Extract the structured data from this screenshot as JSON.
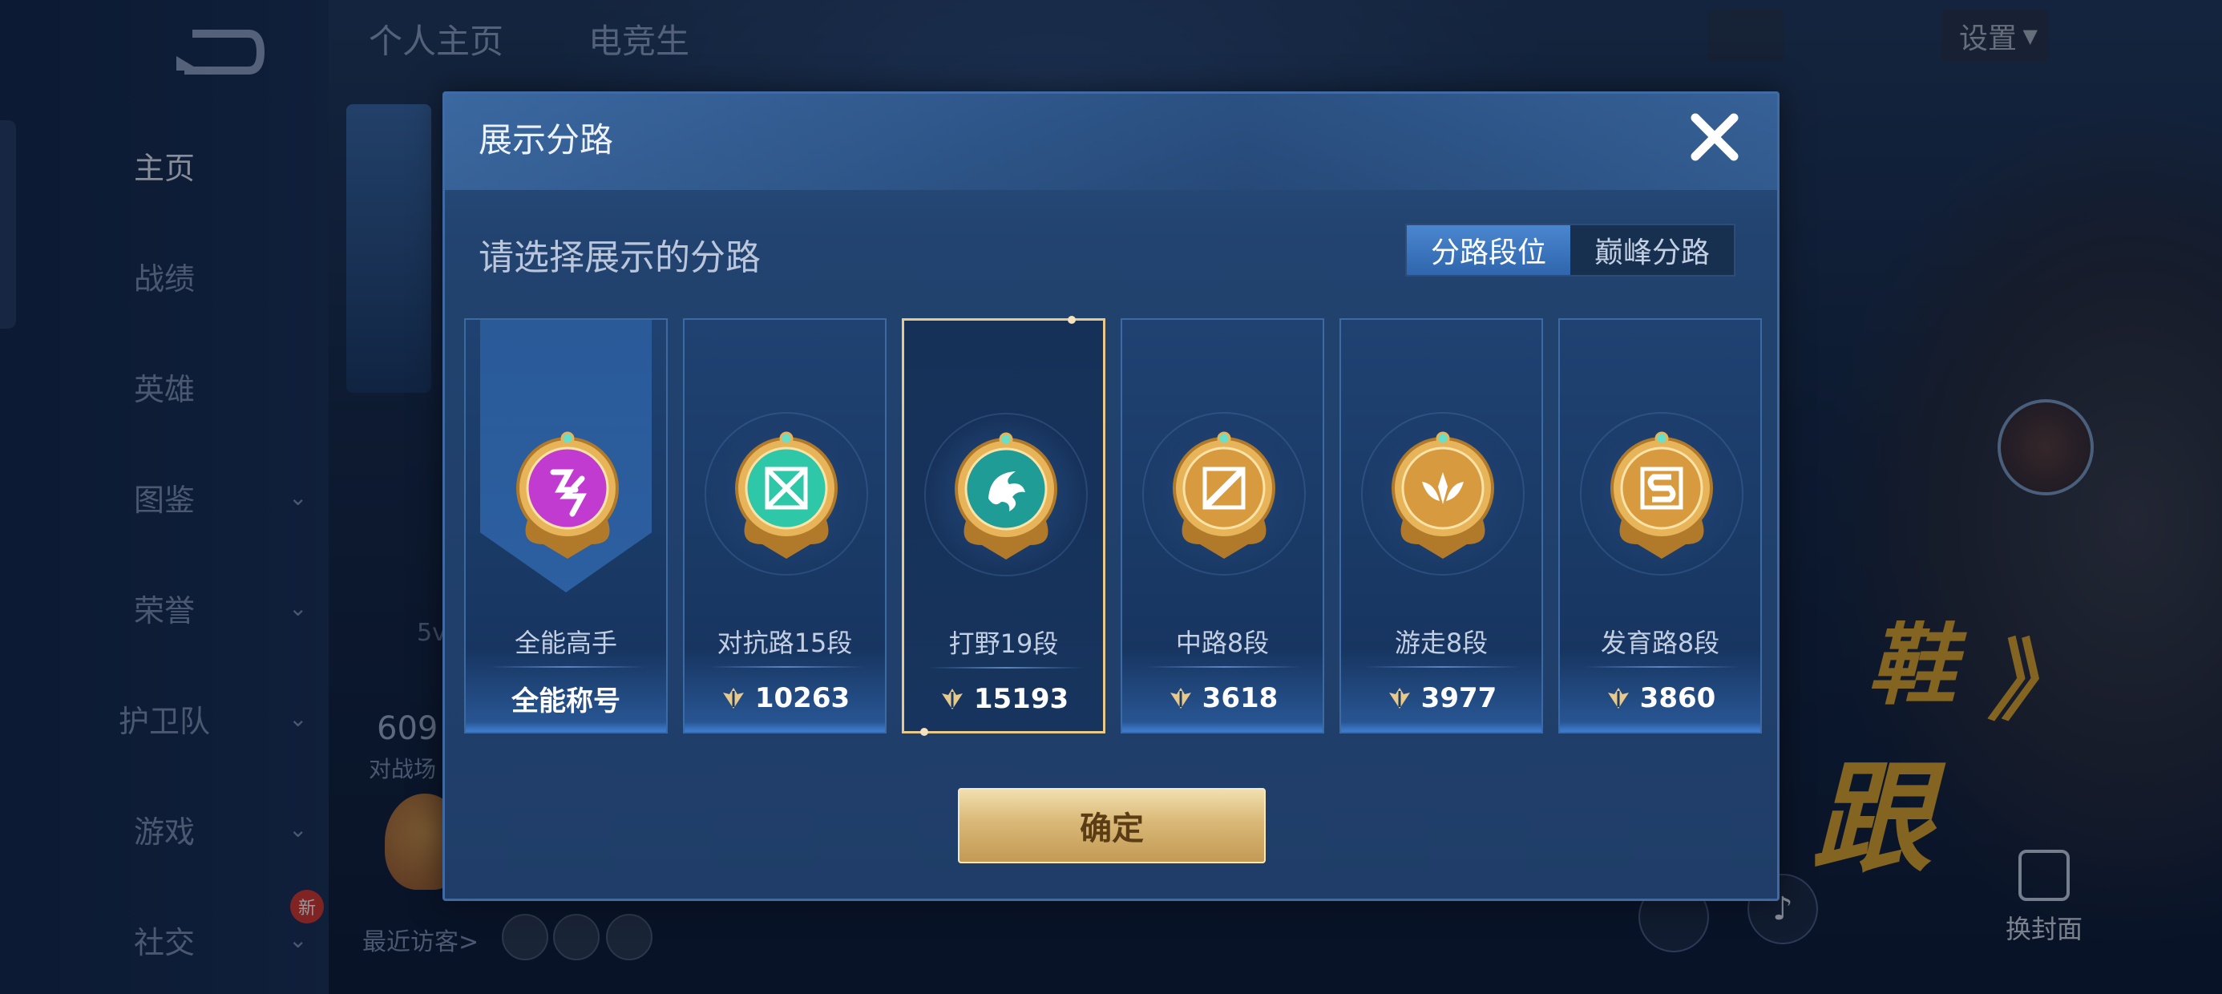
{
  "background": {
    "top_tabs": [
      "个人主页",
      "电竞生"
    ],
    "settings_label": "设置",
    "sidebar": {
      "items": [
        {
          "label": "主页",
          "active": true,
          "has_chevron": false
        },
        {
          "label": "战绩",
          "active": false,
          "has_chevron": false
        },
        {
          "label": "英雄",
          "active": false,
          "has_chevron": false
        },
        {
          "label": "图鉴",
          "active": false,
          "has_chevron": true
        },
        {
          "label": "荣誉",
          "active": false,
          "has_chevron": true
        },
        {
          "label": "护卫队",
          "active": false,
          "has_chevron": true
        },
        {
          "label": "游戏",
          "active": false,
          "has_chevron": true
        },
        {
          "label": "社交",
          "active": false,
          "has_chevron": true
        }
      ],
      "new_badge": "新"
    },
    "recent_visitors_label": "最近访客>",
    "left_number": "609",
    "left_sub": "对战场",
    "left_small": "5v",
    "change_cover_label": "换封面",
    "deco_chars": [
      "鞋",
      "》",
      "跟"
    ]
  },
  "dialog": {
    "title": "展示分路",
    "prompt": "请选择展示的分路",
    "toggle": {
      "options": [
        "分路段位",
        "巅峰分路"
      ],
      "selected_index": 0
    },
    "lanes": [
      {
        "name": "全能高手",
        "value": "全能称号",
        "has_score_icon": false,
        "selected": false,
        "badge": "allround-badge-icon",
        "badge_color": "#c23bd0"
      },
      {
        "name": "对抗路15段",
        "value": "10263",
        "has_score_icon": true,
        "selected": false,
        "badge": "clash-lane-badge-icon",
        "badge_color": "#2ec7a8"
      },
      {
        "name": "打野19段",
        "value": "15193",
        "has_score_icon": true,
        "selected": true,
        "badge": "jungle-badge-icon",
        "badge_color": "#1f9c95"
      },
      {
        "name": "中路8段",
        "value": "3618",
        "has_score_icon": true,
        "selected": false,
        "badge": "mid-lane-badge-icon",
        "badge_color": "#d79a3f"
      },
      {
        "name": "游走8段",
        "value": "3977",
        "has_score_icon": true,
        "selected": false,
        "badge": "roam-badge-icon",
        "badge_color": "#d79a3f"
      },
      {
        "name": "发育路8段",
        "value": "3860",
        "has_score_icon": true,
        "selected": false,
        "badge": "farm-lane-badge-icon",
        "badge_color": "#d79a3f"
      }
    ],
    "confirm_label": "确定"
  },
  "colors": {
    "selected_border": "#e9c98a",
    "confirm_gold": "#d9b877",
    "toggle_active": "#3f78c2"
  }
}
